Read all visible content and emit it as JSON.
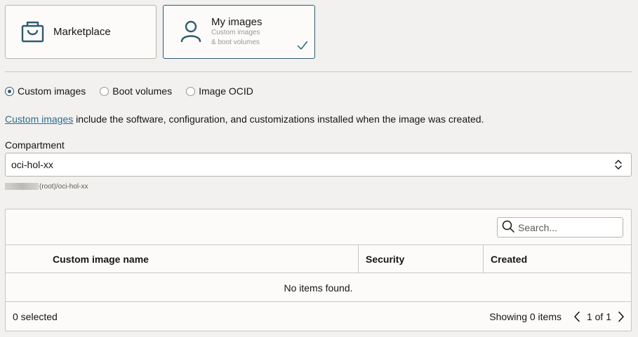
{
  "tiles": {
    "marketplace": {
      "title": "Marketplace"
    },
    "my_images": {
      "title": "My images",
      "subtitle_line1": "Custom images",
      "subtitle_line2": "& boot volumes"
    }
  },
  "radios": [
    {
      "label": "Custom images",
      "checked": true
    },
    {
      "label": "Boot volumes",
      "checked": false
    },
    {
      "label": "Image OCID",
      "checked": false
    }
  ],
  "description": {
    "link": "Custom images",
    "text": " include the software, configuration, and customizations installed when the image was created."
  },
  "compartment": {
    "label": "Compartment",
    "value": "oci-hol-xx",
    "path": "(root)/oci-hol-xx"
  },
  "table": {
    "search_placeholder": "Search...",
    "columns": [
      "Custom image name",
      "Security",
      "Created"
    ],
    "empty_message": "No items found.",
    "selected_text": "0 selected",
    "showing_text": "Showing 0 items",
    "page_text": "1 of 1"
  },
  "colors": {
    "accent": "#2f5b6f",
    "link": "#2e6c8c",
    "background": "#f2f1ef"
  }
}
